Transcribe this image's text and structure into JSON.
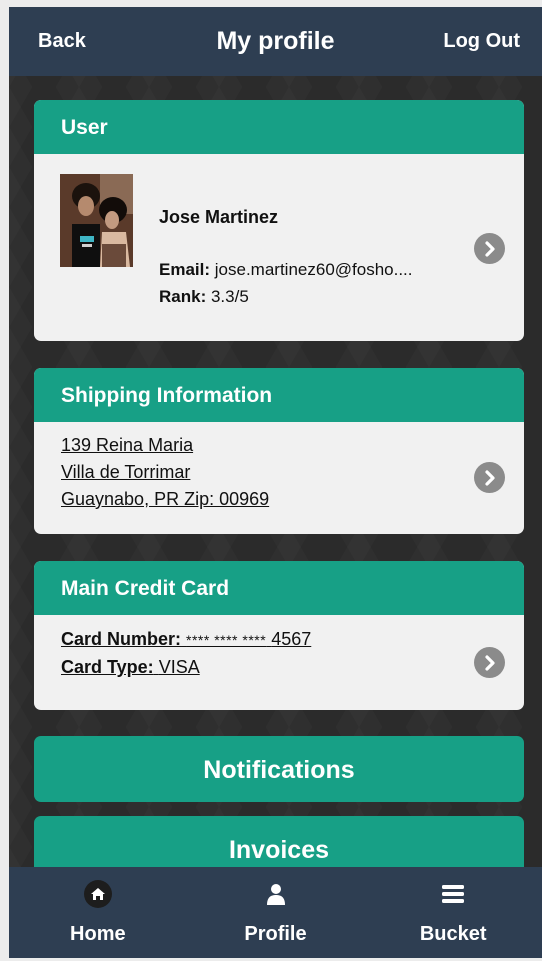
{
  "header": {
    "back_label": "Back",
    "title": "My profile",
    "logout_label": "Log Out"
  },
  "user_card": {
    "title": "User",
    "name": "Jose Martinez",
    "email_label": "Email:",
    "email_value": "jose.martinez60@fosho....",
    "rank_label": "Rank:",
    "rank_value": "3.3/5"
  },
  "shipping_card": {
    "title": "Shipping Information",
    "address_line1": "139 Reina Maria",
    "address_line2": "Villa de Torrimar",
    "address_line3": "Guaynabo, PR Zip: 00969"
  },
  "credit_card": {
    "title": "Main Credit Card",
    "number_label": "Card Number:",
    "number_stars": "**** **** ****",
    "number_last4": "4567",
    "type_label": "Card Type:",
    "type_value": "VISA"
  },
  "buttons": {
    "notifications": "Notifications",
    "invoices": "Invoices"
  },
  "tabbar": {
    "items": [
      {
        "label": "Home",
        "icon": "home-icon"
      },
      {
        "label": "Profile",
        "icon": "person-icon"
      },
      {
        "label": "Bucket",
        "icon": "menu-icon"
      }
    ]
  },
  "colors": {
    "accent": "#17a086",
    "bar": "#2e3e52",
    "background": "#2b2b2b",
    "card": "#f1f1f1"
  }
}
